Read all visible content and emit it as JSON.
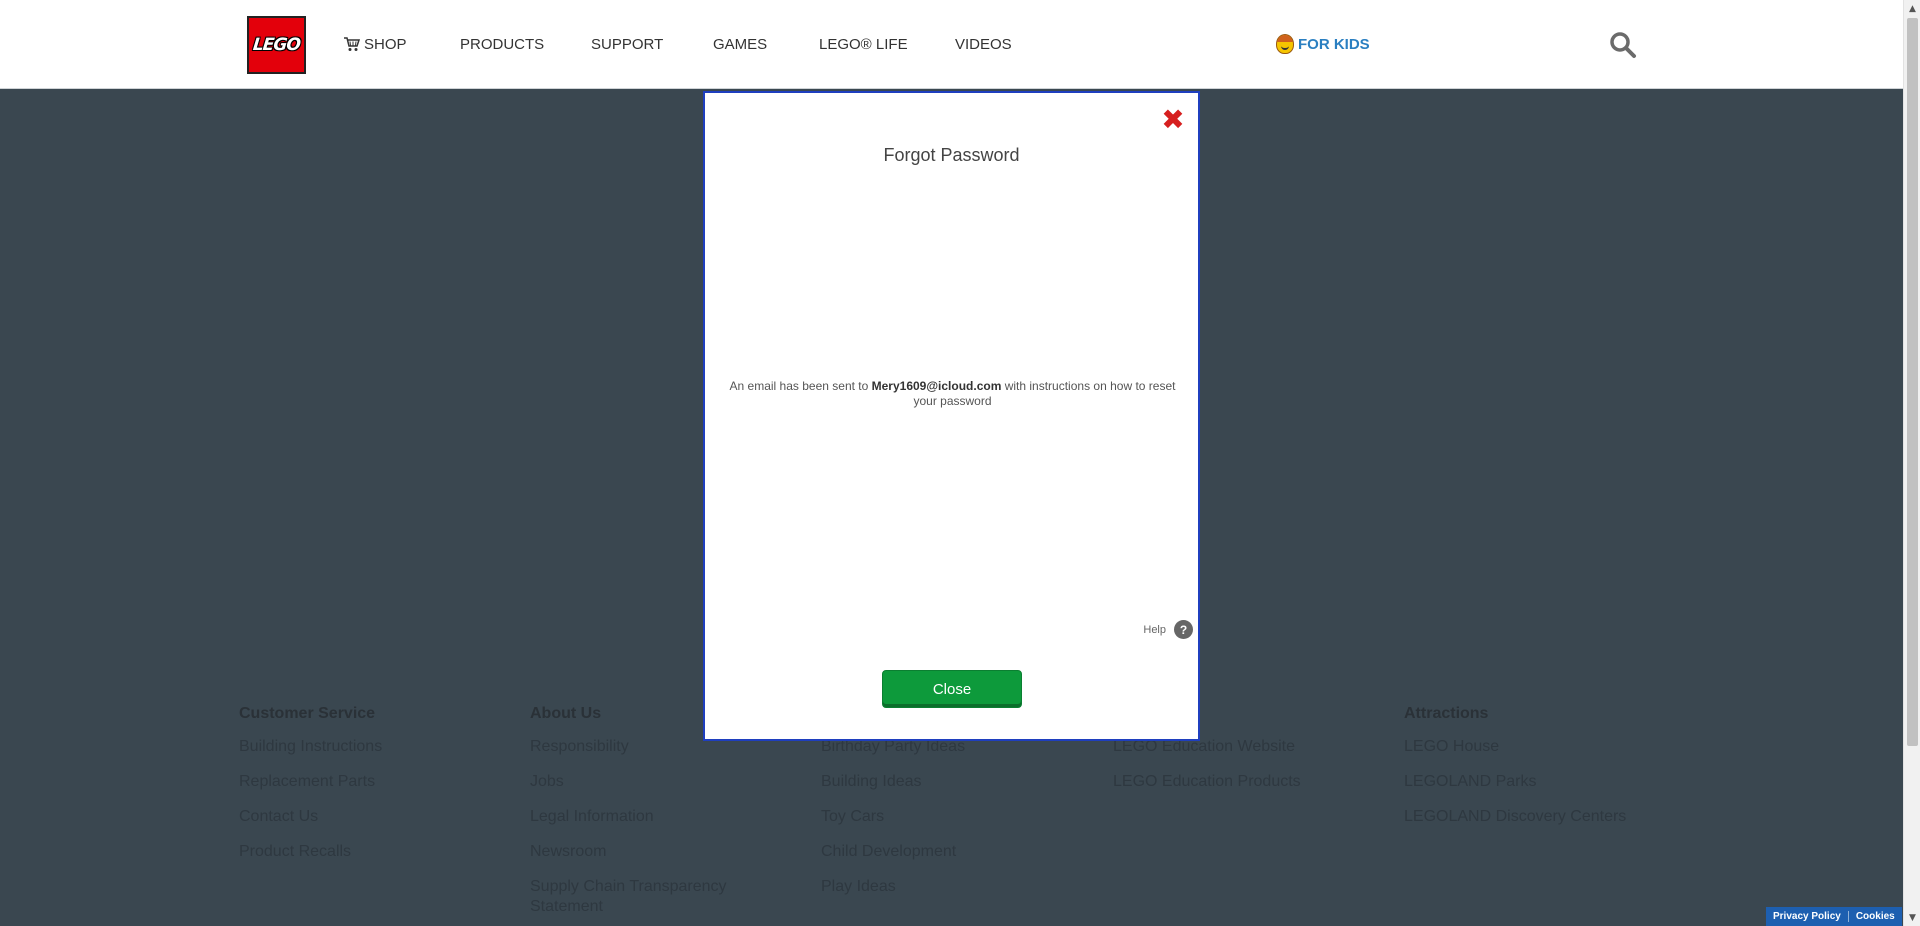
{
  "header": {
    "logo_text": "LEGO",
    "nav": {
      "shop": "SHOP",
      "products": "PRODUCTS",
      "support": "SUPPORT",
      "games": "GAMES",
      "lego_life": "LEGO® LIFE",
      "videos": "VIDEOS",
      "for_kids": "FOR KIDS"
    }
  },
  "footer": {
    "columns": [
      {
        "title": "Customer Service",
        "links": [
          "Building Instructions",
          "Replacement Parts",
          "Contact Us",
          "Product Recalls"
        ]
      },
      {
        "title": "About Us",
        "links": [
          "Responsibility",
          "Jobs",
          "Legal Information",
          "Newsroom",
          "Supply Chain Transparency Statement"
        ]
      },
      {
        "title": "",
        "links": [
          "Birthday Party Ideas",
          "Building Ideas",
          "Toy Cars",
          "Child Development",
          "Play Ideas"
        ]
      },
      {
        "title": "",
        "links": [
          "LEGO Education Website",
          "LEGO Education Products"
        ]
      },
      {
        "title": "Attractions",
        "links": [
          "LEGO House",
          "LEGOLAND Parks",
          "LEGOLAND Discovery Centers"
        ]
      }
    ]
  },
  "modal": {
    "title": "Forgot Password",
    "message_prefix": "An email has been sent to ",
    "email": "Mery1609@icloud.com",
    "message_suffix": " with instructions on how to reset your password",
    "help_label": "Help",
    "help_icon_text": "?",
    "close_button": "Close",
    "close_x": "✖"
  },
  "cookie_bar": {
    "privacy": "Privacy Policy",
    "cookies": "Cookies"
  },
  "scrollbar": {
    "up": "▲",
    "down": "▼"
  },
  "colors": {
    "overlay": "#3a4750",
    "lego_red": "#e3000b",
    "kids_blue": "#2a7fc1",
    "button_green": "#0d9a3b",
    "modal_border": "#1f3fbf",
    "close_x_red": "#d61f1f"
  }
}
